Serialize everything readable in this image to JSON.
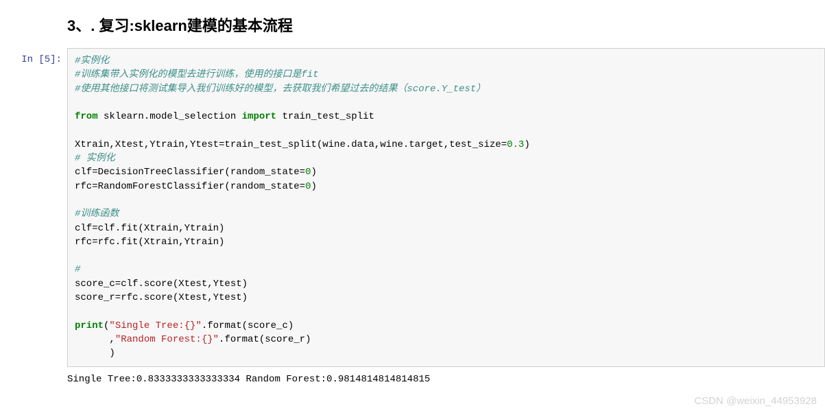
{
  "heading": "3、. 复习:sklearn建模的基本流程",
  "prompt": {
    "in": "In  [5]:"
  },
  "code": {
    "l1": "#实例化",
    "l2": "#训练集带入实例化的模型去进行训练，使用的接口是fit",
    "l3": "#使用其他接口将测试集导入我们训练好的模型，去获取我们希望过去的结果（score.Y_test）",
    "l4a": "from",
    "l4b": " sklearn.model_selection ",
    "l4c": "import",
    "l4d": " train_test_split",
    "l5a": "Xtrain,Xtest,Ytrain,Ytest=train_test_split(wine.data,wine.target,test_size=",
    "l5b": "0.3",
    "l5c": ")",
    "l6": "# 实例化",
    "l7a": "clf=DecisionTreeClassifier(random_state=",
    "l7b": "0",
    "l7c": ")",
    "l8a": "rfc=RandomForestClassifier(random_state=",
    "l8b": "0",
    "l8c": ")",
    "l9": "#训练函数",
    "l10": "clf=clf.fit(Xtrain,Ytrain)",
    "l11": "rfc=rfc.fit(Xtrain,Ytrain)",
    "l12": "#",
    "l13": "score_c=clf.score(Xtest,Ytest)",
    "l14": "score_r=rfc.score(Xtest,Ytest)",
    "l15a": "print",
    "l15b": "(",
    "l15c": "\"Single Tree:{}\"",
    "l15d": ".format(score_c)",
    "l16a": "      ,",
    "l16b": "\"Random Forest:{}\"",
    "l16c": ".format(score_r)",
    "l17": "      )"
  },
  "output": "Single Tree:0.8333333333333334 Random Forest:0.9814814814814815",
  "watermark": "CSDN @weixin_44953928"
}
